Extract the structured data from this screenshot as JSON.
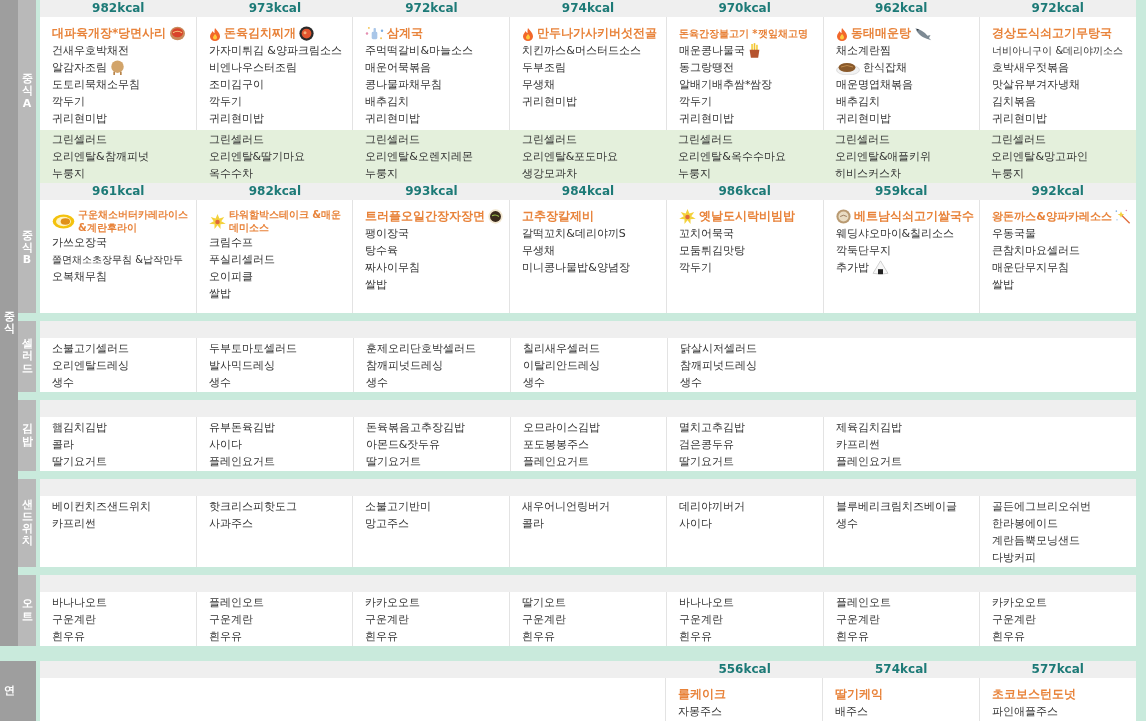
{
  "groups": [
    {
      "label": "중식",
      "blocks": [
        {
          "sections": [
            {
              "label": "중식A",
              "days": [
                {
                  "kcal": "982kcal",
                  "title": "대파육개장*당면사리",
                  "items": [
                    "건새우호박채전",
                    "알감자조림",
                    "도토리묵채소무침",
                    "깍두기",
                    "귀리현미밥"
                  ],
                  "extras": [
                    "그린셀러드",
                    "오리엔탈&참깨피넛",
                    "누룽지"
                  ]
                },
                {
                  "kcal": "973kcal",
                  "title": "돈육김치찌개",
                  "items": [
                    "가자미튀김 &양파크림소스",
                    "비엔나우스터조림",
                    "조미김구이",
                    "깍두기",
                    "귀리현미밥"
                  ],
                  "extras": [
                    "그린셀러드",
                    "오리엔탈&딸기마요",
                    "옥수수차"
                  ]
                },
                {
                  "kcal": "972kcal",
                  "title": "삼계국",
                  "items": [
                    "주먹떡갈비&마늘소스",
                    "매운어묵볶음",
                    "콩나물파채무침",
                    "배추김치",
                    "귀리현미밥"
                  ],
                  "extras": [
                    "그린셀러드",
                    "오리엔탈&오렌지레몬",
                    "누룽지"
                  ]
                },
                {
                  "kcal": "974kcal",
                  "title": "만두나가사키버섯전골",
                  "items": [
                    "치킨까스&머스터드소스",
                    "두부조림",
                    "무생채",
                    "귀리현미밥"
                  ],
                  "extras": [
                    "그린셀러드",
                    "오리엔탈&포도마요",
                    "생강모과차"
                  ]
                },
                {
                  "kcal": "970kcal",
                  "title": "돈육간장불고기 *깻잎채고명",
                  "items": [
                    "매운콩나물국",
                    "동그랑땡전",
                    "알배기배추쌈*쌈장",
                    "깍두기",
                    "귀리현미밥"
                  ],
                  "extras": [
                    "그린셀러드",
                    "오리엔탈&옥수수마요",
                    "누룽지"
                  ]
                },
                {
                  "kcal": "962kcal",
                  "title": "동태매운탕",
                  "items": [
                    "채소계란찜",
                    "한식잡채",
                    "매운명엽채볶음",
                    "배추김치",
                    "귀리현미밥"
                  ],
                  "extras": [
                    "그린셀러드",
                    "오리엔탈&애플키위",
                    "히비스커스차"
                  ]
                },
                {
                  "kcal": "972kcal",
                  "title": "경상도식쇠고기무탕국",
                  "items": [
                    "너비아니구이 &데리야끼소스",
                    "호박새우젓볶음",
                    "맛살유부겨자냉채",
                    "김치볶음",
                    "귀리현미밥"
                  ],
                  "extras": [
                    "그린셀러드",
                    "오리엔탈&망고파인",
                    "누룽지"
                  ]
                }
              ]
            },
            {
              "label": "중식B",
              "days": [
                {
                  "kcal": "961kcal",
                  "title": "구운채소버터카레라이스 &계란후라이",
                  "items": [
                    "가쓰오장국",
                    "쫄면채소초장무침 &납작만두",
                    "오복채무침"
                  ]
                },
                {
                  "kcal": "982kcal",
                  "title": "타워함박스테이크 &매운데미소스",
                  "items": [
                    "크림수프",
                    "푸실리셀러드",
                    "오이피클",
                    "쌀밥"
                  ]
                },
                {
                  "kcal": "993kcal",
                  "title": "트러플오일간장자장면",
                  "items": [
                    "팽이장국",
                    "탕수육",
                    "짜사이무침",
                    "쌀밥"
                  ]
                },
                {
                  "kcal": "984kcal",
                  "title": "고추장칼제비",
                  "items": [
                    "갈떡꼬치&데리야끼S",
                    "무생채",
                    "미니콩나물밥&양념장"
                  ]
                },
                {
                  "kcal": "986kcal",
                  "title": "옛날도시락비빔밥",
                  "items": [
                    "꼬치어묵국",
                    "모둠튀김맛탕",
                    "깍두기"
                  ]
                },
                {
                  "kcal": "959kcal",
                  "title": "베트남식쇠고기쌀국수",
                  "items": [
                    "웨딩샤오마이&칠리소스",
                    "깍둑단무지",
                    "추가밥"
                  ]
                },
                {
                  "kcal": "992kcal",
                  "title": "왕돈까스&양파카레소스",
                  "items": [
                    "우동국물",
                    "큰참치마요셀러드",
                    "매운단무지무침",
                    "쌀밥"
                  ]
                }
              ]
            }
          ]
        },
        {
          "sections": [
            {
              "label": "셀러드",
              "days": [
                {
                  "items": [
                    "소불고기셀러드",
                    "오리엔탈드레싱",
                    "생수"
                  ]
                },
                {
                  "items": [
                    "두부토마토셀러드",
                    "발사믹드레싱",
                    "생수"
                  ]
                },
                {
                  "items": [
                    "훈제오리단호박셀러드",
                    "참깨피넛드레싱",
                    "생수"
                  ]
                },
                {
                  "items": [
                    "칠리새우셀러드",
                    "이탈리안드레싱",
                    "생수"
                  ]
                },
                {
                  "items": [
                    "닭살시저셀러드",
                    "참깨피넛드레싱",
                    "생수"
                  ]
                }
              ]
            }
          ]
        },
        {
          "sections": [
            {
              "label": "김밥",
              "days": [
                {
                  "items": [
                    "햄김치김밥",
                    "콜라",
                    "딸기요거트"
                  ]
                },
                {
                  "items": [
                    "유부돈육김밥",
                    "사이다",
                    "플레인요거트"
                  ]
                },
                {
                  "items": [
                    "돈육볶음고추장김밥",
                    "아몬드&잣두유",
                    "딸기요거트"
                  ]
                },
                {
                  "items": [
                    "오므라이스김밥",
                    "포도봉봉주스",
                    "플레인요거트"
                  ]
                },
                {
                  "items": [
                    "멸치고추김밥",
                    "검은콩두유",
                    "딸기요거트"
                  ]
                },
                {
                  "items": [
                    "제육김치김밥",
                    "카프리썬",
                    "플레인요거트"
                  ]
                }
              ]
            }
          ]
        },
        {
          "sections": [
            {
              "label": "샌드위치",
              "days": [
                {
                  "items": [
                    "베이컨치즈샌드위치",
                    "카프리썬"
                  ]
                },
                {
                  "items": [
                    "핫크리스피핫도그",
                    "사과주스"
                  ]
                },
                {
                  "items": [
                    "소불고기반미",
                    "망고주스"
                  ]
                },
                {
                  "items": [
                    "새우어니언링버거",
                    "콜라"
                  ]
                },
                {
                  "items": [
                    "데리야끼버거",
                    "사이다"
                  ]
                },
                {
                  "items": [
                    "블루베리크림치즈베이글",
                    "생수"
                  ]
                },
                {
                  "items": [
                    "골든에그브리오쉬번",
                    "한라봉에이드",
                    "계란듬뿍모닝샌드",
                    "다방커피"
                  ]
                }
              ]
            }
          ]
        },
        {
          "sections": [
            {
              "label": "오트",
              "days": [
                {
                  "items": [
                    "바나나오트",
                    "구운계란",
                    "흰우유"
                  ]
                },
                {
                  "items": [
                    "플레인오트",
                    "구운계란",
                    "흰우유"
                  ]
                },
                {
                  "items": [
                    "카카오오트",
                    "구운계란",
                    "흰우유"
                  ]
                },
                {
                  "items": [
                    "딸기오트",
                    "구운계란",
                    "흰우유"
                  ]
                },
                {
                  "items": [
                    "바나나오트",
                    "구운계란",
                    "흰우유"
                  ]
                },
                {
                  "items": [
                    "플레인오트",
                    "구운계란",
                    "흰우유"
                  ]
                },
                {
                  "items": [
                    "카카오오트",
                    "구운계란",
                    "흰우유"
                  ]
                }
              ]
            }
          ]
        }
      ]
    },
    {
      "label": "연",
      "blocks": [
        {
          "sections": [
            {
              "days": [
                {
                  "kcal": "556kcal",
                  "title": "롤케이크",
                  "items": [
                    "자몽주스"
                  ]
                },
                {
                  "kcal": "574kcal",
                  "title": "딸기케익",
                  "items": [
                    "배주스"
                  ]
                },
                {
                  "kcal": "577kcal",
                  "title": "초코보스턴도넛",
                  "items": [
                    "파인애플주스"
                  ]
                }
              ]
            }
          ]
        }
      ]
    }
  ]
}
